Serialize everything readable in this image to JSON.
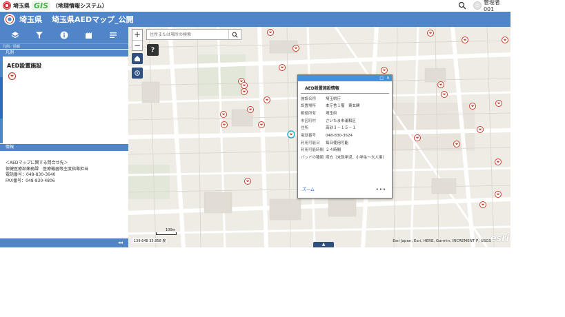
{
  "header": {
    "org_name": "埼玉県",
    "gis_logo": "GIS",
    "system_name": "（地理情報システム）",
    "search_icon": "search-icon",
    "user_name": "管理者001"
  },
  "appbar": {
    "pref_name": "埼玉県",
    "title": "埼玉県AEDマップ_公開"
  },
  "left_panel": {
    "toolbar_icons": [
      "layers-icon",
      "filter-icon",
      "info-icon",
      "bookmark-icon",
      "list-icon"
    ],
    "breadcrumb": "凡例／情報",
    "legend_header": "凡例",
    "legend_title": "AED設置施設",
    "info_header": "情報",
    "info_lines": [
      "＜AEDマップに関する問合せ先＞",
      "保健医療部薬務課　医療機器等主度指導担当",
      "電話番号：048-830-3640",
      "FAX番号：048-830-4806"
    ],
    "collapse_label": "◂◂"
  },
  "map": {
    "search_placeholder": "住所または場所の検索",
    "zoom_in": "+",
    "zoom_out": "−",
    "help": "?",
    "coordinates": "139.648 35.858 度",
    "scale_label": "100m",
    "attribution": "Esri Japan, Esri, HERE, Garmin, INCREMENT P, USGS",
    "esri_logo": "esri",
    "up_tab": "▲"
  },
  "popup": {
    "window_buttons": [
      "□",
      "✕"
    ],
    "title": "AED設置施設情報",
    "fields": [
      {
        "label": "施設名称",
        "value": "埼玉県庁"
      },
      {
        "label": "設置場所",
        "value": "本庁舎１階　東玄関"
      },
      {
        "label": "郵便所有",
        "value": "埼玉県"
      },
      {
        "label": "市区町村",
        "value": "さいたま市浦和区"
      },
      {
        "label": "住所",
        "value": "高砂３－１５－１"
      },
      {
        "label": "電話番号",
        "value": "048-830-3624"
      },
      {
        "label": "利用可能日",
        "value": "毎日使用可能"
      },
      {
        "label": "利用可能時間",
        "value": "２４時間"
      },
      {
        "label": "パッドの種類",
        "value": "両方（未就学児、小学生～大人用）"
      }
    ],
    "zoom_link": "ズーム",
    "more": "•••"
  },
  "colors": {
    "header_blue": "#5185c9",
    "popup_blue": "#4a90d9",
    "marker_red": "#c8402e",
    "map_background": "#efece6"
  }
}
